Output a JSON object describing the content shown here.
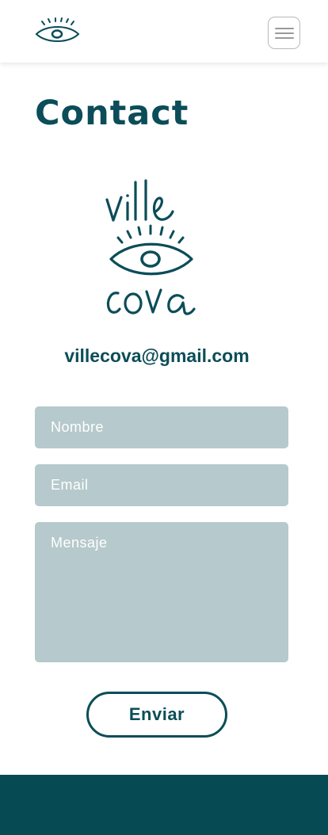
{
  "header": {
    "logo_icon": "eye-icon",
    "menu_icon": "hamburger-menu-icon"
  },
  "main": {
    "title": "Contact",
    "brand_logo_text_top": "ville",
    "brand_logo_text_bottom": "cova",
    "email": "villecova@gmail.com"
  },
  "form": {
    "name_placeholder": "Nombre",
    "email_placeholder": "Email",
    "message_placeholder": "Mensaje",
    "submit_label": "Enviar"
  },
  "colors": {
    "brand": "#0b4d58",
    "field_bg": "#b6c9cc",
    "footer_bg": "#064a54"
  }
}
